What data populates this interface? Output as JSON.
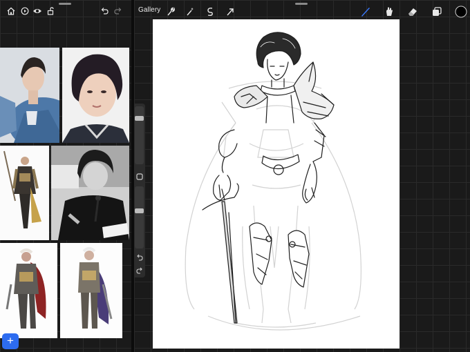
{
  "left_toolbar": {
    "icons": [
      "home-icon",
      "play-circle-icon",
      "eye-icon",
      "unlock-icon",
      "undo-icon",
      "redo-icon"
    ]
  },
  "reference_images": [
    {
      "name": "photo-portrait-denim-jacket"
    },
    {
      "name": "photo-portrait-curly-hair"
    },
    {
      "name": "illustration-armored-knight-gold"
    },
    {
      "name": "photo-man-with-microphone"
    },
    {
      "name": "illustration-armored-knight-red-cape"
    },
    {
      "name": "illustration-armored-knight-purple-cape"
    }
  ],
  "add_button": {
    "label": "+"
  },
  "right_toolbar": {
    "gallery_label": "Gallery",
    "left_icons": [
      "wrench-icon",
      "magic-wand-icon",
      "selection-icon",
      "transform-arrow-icon"
    ],
    "right_icons": [
      "brush-icon",
      "smudge-icon",
      "eraser-icon",
      "layers-icon",
      "color-swatch-icon"
    ]
  },
  "side_slider": {
    "brush_size_level": 0.82,
    "opacity_level": 0.62,
    "icons": [
      "modify-square-icon",
      "undo-arrow-icon",
      "redo-arrow-icon"
    ]
  },
  "colors": {
    "brush_accent": "#3a7bff",
    "active_color": "#000000",
    "canvas": "#ffffff",
    "add_button": "#2d6cf0"
  }
}
